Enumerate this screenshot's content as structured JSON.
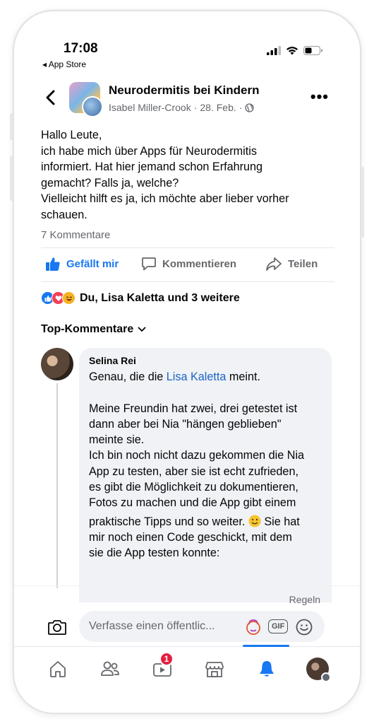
{
  "status_bar": {
    "time": "17:08",
    "back_app": "◂ App Store"
  },
  "header": {
    "group_name": "Neurodermitis bei Kindern",
    "author": "Isabel Miller-Crook",
    "date": "28. Feb.",
    "separator": "·",
    "privacy_icon": "globe-icon"
  },
  "post": {
    "lines": [
      "Hallo Leute,",
      "ich habe mich über Apps für Neurodermitis",
      "informiert. Hat hier jemand schon Erfahrung",
      "gemacht? Falls ja, welche?",
      "Vielleicht hilft es ja, ich möchte aber lieber vorher",
      "schauen."
    ],
    "comment_count": "7 Kommentare"
  },
  "actions": {
    "like": "Gefällt mir",
    "comment": "Kommentieren",
    "share": "Teilen"
  },
  "reactions": {
    "text": "Du, Lisa Kaletta und 3 weitere",
    "icons": [
      "like-icon",
      "love-icon",
      "haha-icon"
    ]
  },
  "sort": {
    "label": "Top-Kommentare"
  },
  "comment": {
    "author": "Selina Rei",
    "line1_prefix": "Genau, die die ",
    "line1_link": "Lisa Kaletta",
    "line1_suffix": " meint.",
    "lines": [
      "",
      "Meine Freundin hat zwei, drei getestet ist",
      "dann aber bei Nia \"hängen geblieben\"",
      "meinte sie.",
      "Ich bin noch nicht dazu gekommen die Nia",
      "App zu testen, aber sie ist echt zufrieden,",
      "es gibt die Möglichkeit zu dokumentieren,",
      "Fotos zu machen und die App gibt einem"
    ],
    "line_emoji_prefix": "praktische Tipps und so weiter. ",
    "line_emoji_suffix": "  Sie hat",
    "lines_end": [
      "mir noch einen Code geschickt, mit dem",
      "sie die App testen konnte:"
    ]
  },
  "rules_label": "Regeln",
  "composer": {
    "placeholder": "Verfasse einen öffentlic...",
    "gif_label": "GIF"
  },
  "nav": {
    "items": [
      "home-icon",
      "groups-icon",
      "watch-icon",
      "marketplace-icon",
      "notifications-icon",
      "profile-menu-icon"
    ],
    "watch_badge": "1",
    "active": "notifications-icon"
  },
  "colors": {
    "accent": "#1877f2",
    "link": "#1a63c9",
    "badge": "#e41e3f",
    "muted": "#65676b",
    "bubble": "#f0f2f5"
  }
}
